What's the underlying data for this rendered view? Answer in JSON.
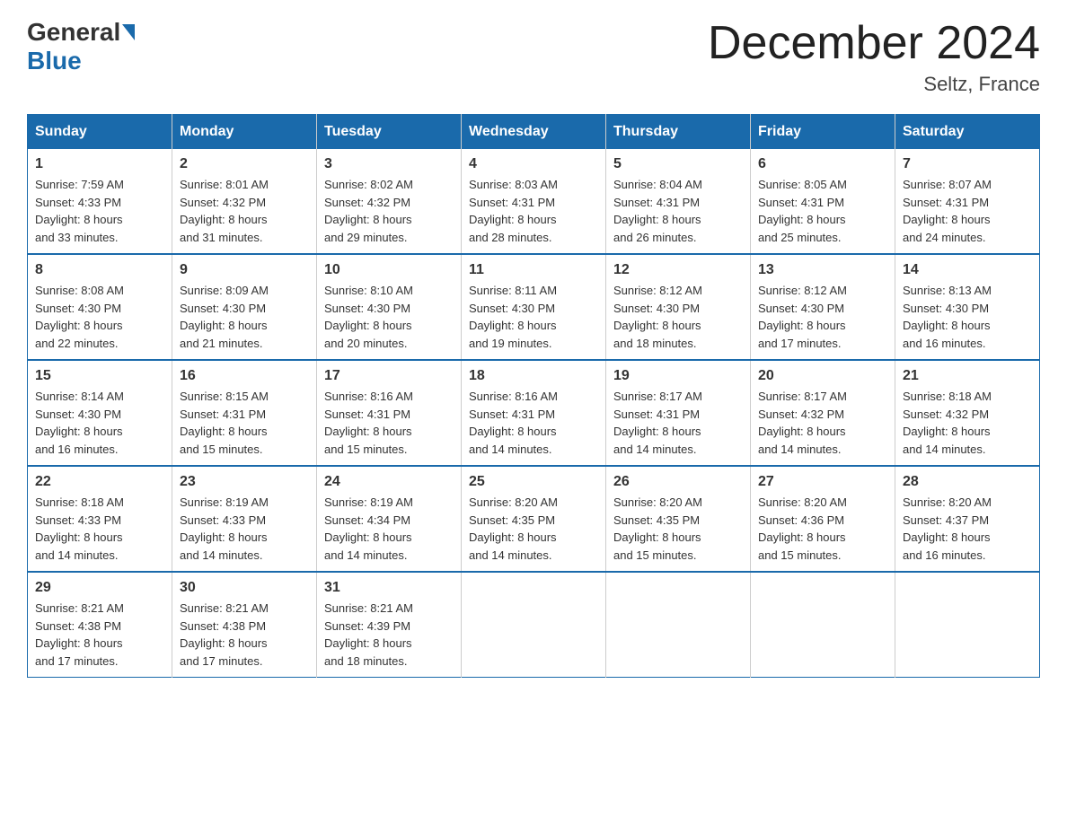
{
  "header": {
    "logo_general": "General",
    "logo_blue": "Blue",
    "title": "December 2024",
    "location": "Seltz, France"
  },
  "days_of_week": [
    "Sunday",
    "Monday",
    "Tuesday",
    "Wednesday",
    "Thursday",
    "Friday",
    "Saturday"
  ],
  "weeks": [
    [
      {
        "day": "1",
        "sunrise": "7:59 AM",
        "sunset": "4:33 PM",
        "daylight": "8 hours and 33 minutes."
      },
      {
        "day": "2",
        "sunrise": "8:01 AM",
        "sunset": "4:32 PM",
        "daylight": "8 hours and 31 minutes."
      },
      {
        "day": "3",
        "sunrise": "8:02 AM",
        "sunset": "4:32 PM",
        "daylight": "8 hours and 29 minutes."
      },
      {
        "day": "4",
        "sunrise": "8:03 AM",
        "sunset": "4:31 PM",
        "daylight": "8 hours and 28 minutes."
      },
      {
        "day": "5",
        "sunrise": "8:04 AM",
        "sunset": "4:31 PM",
        "daylight": "8 hours and 26 minutes."
      },
      {
        "day": "6",
        "sunrise": "8:05 AM",
        "sunset": "4:31 PM",
        "daylight": "8 hours and 25 minutes."
      },
      {
        "day": "7",
        "sunrise": "8:07 AM",
        "sunset": "4:31 PM",
        "daylight": "8 hours and 24 minutes."
      }
    ],
    [
      {
        "day": "8",
        "sunrise": "8:08 AM",
        "sunset": "4:30 PM",
        "daylight": "8 hours and 22 minutes."
      },
      {
        "day": "9",
        "sunrise": "8:09 AM",
        "sunset": "4:30 PM",
        "daylight": "8 hours and 21 minutes."
      },
      {
        "day": "10",
        "sunrise": "8:10 AM",
        "sunset": "4:30 PM",
        "daylight": "8 hours and 20 minutes."
      },
      {
        "day": "11",
        "sunrise": "8:11 AM",
        "sunset": "4:30 PM",
        "daylight": "8 hours and 19 minutes."
      },
      {
        "day": "12",
        "sunrise": "8:12 AM",
        "sunset": "4:30 PM",
        "daylight": "8 hours and 18 minutes."
      },
      {
        "day": "13",
        "sunrise": "8:12 AM",
        "sunset": "4:30 PM",
        "daylight": "8 hours and 17 minutes."
      },
      {
        "day": "14",
        "sunrise": "8:13 AM",
        "sunset": "4:30 PM",
        "daylight": "8 hours and 16 minutes."
      }
    ],
    [
      {
        "day": "15",
        "sunrise": "8:14 AM",
        "sunset": "4:30 PM",
        "daylight": "8 hours and 16 minutes."
      },
      {
        "day": "16",
        "sunrise": "8:15 AM",
        "sunset": "4:31 PM",
        "daylight": "8 hours and 15 minutes."
      },
      {
        "day": "17",
        "sunrise": "8:16 AM",
        "sunset": "4:31 PM",
        "daylight": "8 hours and 15 minutes."
      },
      {
        "day": "18",
        "sunrise": "8:16 AM",
        "sunset": "4:31 PM",
        "daylight": "8 hours and 14 minutes."
      },
      {
        "day": "19",
        "sunrise": "8:17 AM",
        "sunset": "4:31 PM",
        "daylight": "8 hours and 14 minutes."
      },
      {
        "day": "20",
        "sunrise": "8:17 AM",
        "sunset": "4:32 PM",
        "daylight": "8 hours and 14 minutes."
      },
      {
        "day": "21",
        "sunrise": "8:18 AM",
        "sunset": "4:32 PM",
        "daylight": "8 hours and 14 minutes."
      }
    ],
    [
      {
        "day": "22",
        "sunrise": "8:18 AM",
        "sunset": "4:33 PM",
        "daylight": "8 hours and 14 minutes."
      },
      {
        "day": "23",
        "sunrise": "8:19 AM",
        "sunset": "4:33 PM",
        "daylight": "8 hours and 14 minutes."
      },
      {
        "day": "24",
        "sunrise": "8:19 AM",
        "sunset": "4:34 PM",
        "daylight": "8 hours and 14 minutes."
      },
      {
        "day": "25",
        "sunrise": "8:20 AM",
        "sunset": "4:35 PM",
        "daylight": "8 hours and 14 minutes."
      },
      {
        "day": "26",
        "sunrise": "8:20 AM",
        "sunset": "4:35 PM",
        "daylight": "8 hours and 15 minutes."
      },
      {
        "day": "27",
        "sunrise": "8:20 AM",
        "sunset": "4:36 PM",
        "daylight": "8 hours and 15 minutes."
      },
      {
        "day": "28",
        "sunrise": "8:20 AM",
        "sunset": "4:37 PM",
        "daylight": "8 hours and 16 minutes."
      }
    ],
    [
      {
        "day": "29",
        "sunrise": "8:21 AM",
        "sunset": "4:38 PM",
        "daylight": "8 hours and 17 minutes."
      },
      {
        "day": "30",
        "sunrise": "8:21 AM",
        "sunset": "4:38 PM",
        "daylight": "8 hours and 17 minutes."
      },
      {
        "day": "31",
        "sunrise": "8:21 AM",
        "sunset": "4:39 PM",
        "daylight": "8 hours and 18 minutes."
      },
      null,
      null,
      null,
      null
    ]
  ],
  "labels": {
    "sunrise": "Sunrise:",
    "sunset": "Sunset:",
    "daylight": "Daylight:"
  }
}
